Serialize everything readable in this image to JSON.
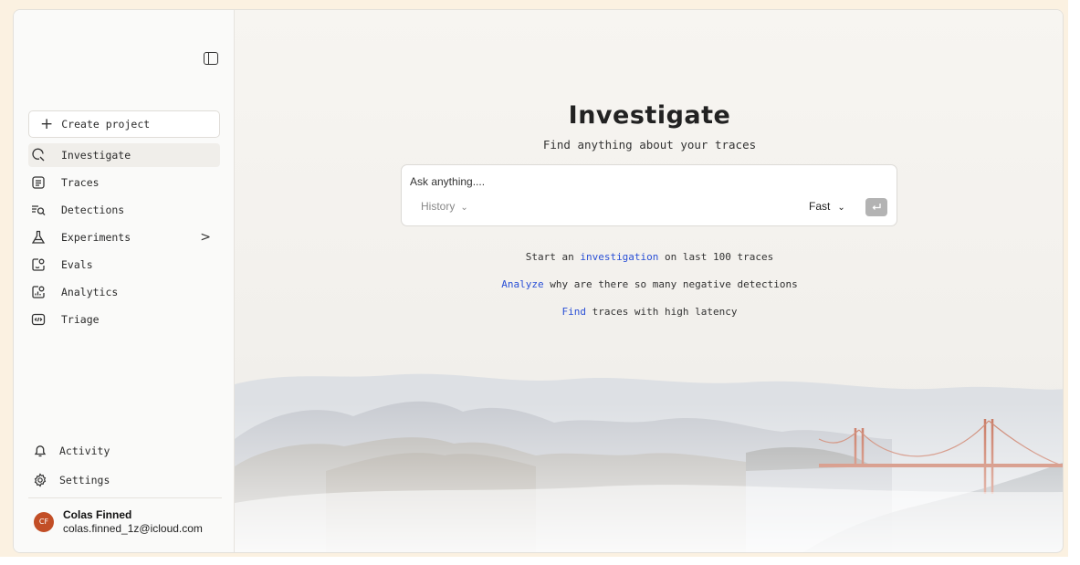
{
  "sidebar": {
    "collapse_icon": "sidebar-toggle-icon",
    "create_project": "Create project",
    "items": [
      {
        "label": "Investigate",
        "icon": "investigate-icon",
        "active": true
      },
      {
        "label": "Traces",
        "icon": "traces-icon"
      },
      {
        "label": "Detections",
        "icon": "detections-icon"
      },
      {
        "label": "Experiments",
        "icon": "flask-icon",
        "has_submenu": true
      },
      {
        "label": "Evals",
        "icon": "evals-icon"
      },
      {
        "label": "Analytics",
        "icon": "analytics-icon"
      },
      {
        "label": "Triage",
        "icon": "code-icon"
      }
    ],
    "bottom_items": [
      {
        "label": "Activity",
        "icon": "bell-icon"
      },
      {
        "label": "Settings",
        "icon": "gear-icon"
      }
    ],
    "user": {
      "initials": "CF",
      "name": "Colas Finned",
      "email": "colas.finned_1z@icloud.com",
      "avatar_color": "#c24e26"
    }
  },
  "main": {
    "title": "Investigate",
    "subtitle": "Find anything about your traces",
    "search": {
      "placeholder": "Ask anything....",
      "history_label": "History",
      "mode_label": "Fast"
    },
    "suggestions": [
      {
        "before": "Start an ",
        "link": "investigation",
        "after": " on last 100 traces"
      },
      {
        "before": "",
        "link": "Analyze",
        "after": " why are there so many negative detections"
      },
      {
        "before": "",
        "link": "Find",
        "after": " traces with high latency"
      }
    ],
    "link_color": "#2a50d6"
  }
}
